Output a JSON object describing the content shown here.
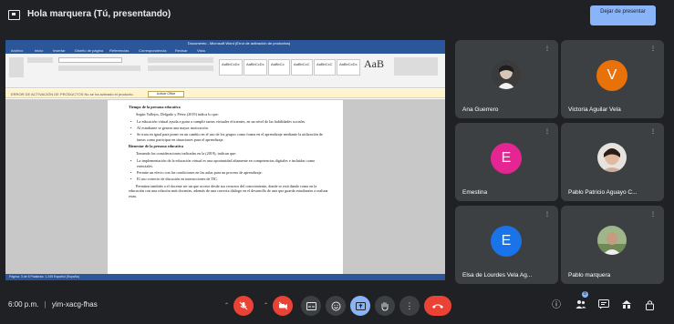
{
  "presentation": {
    "title": "Hola marquera (Tú, presentando)",
    "stop_label": "Dejar de presentar"
  },
  "word": {
    "title_bar": "Documento - Microsoft Word (Error de activación de productos)",
    "tabs": [
      "Archivo",
      "Inicio",
      "Insertar",
      "Diseño de página",
      "Referencias",
      "Correspondencia",
      "Revisar",
      "Vista"
    ],
    "style_gallery": [
      "AaBbCcDc",
      "AaBbCcDc",
      "AaBbCc",
      "AaBbCcC",
      "AaBbCcC",
      "AaBbCcDc"
    ],
    "style_big": "AaB",
    "warning_text": "ERROR DE ACTIVACIÓN DE PRODUCTOS   No se ha activado el producto.",
    "warning_button": "Activar Office",
    "status_text": "Página: 3 de 5   Palabras: 1.245   Español (España)",
    "document": {
      "heading1": "Tiempo de la persona educativa",
      "para1": "Según Vallejos, Delgado y Pérez (2019) indica lo que:",
      "bullets1": [
        "La educación virtual ayuda a guiar a cumplir tareas virtuales eficientes, en un nivel de las habilidades sociales.",
        "Al estudiante se genera una mayor motivación.",
        "Se trata en igual para poner en un cambio en el uso de los grupos como forma en el aprendizaje mediante la utilización de tareas como participar en situaciones para el aprendizaje."
      ],
      "heading2": "Bienestar de la persona educativa",
      "para2": "Tomando las consideraciones indicadas en la (2019), indican que:",
      "bullets2": [
        "La implementación de la educación virtual es una oportunidad altamente en competencias digitales e incluidas como esenciales.",
        "Permite un efecto con las condiciones en las aulas para un proceso de aprendizaje.",
        "El uso correcto de discusión en interacciones de TIC."
      ],
      "para3": "Permiten también a el docente ser un que acceso desde sus recursos del conocimiento, donde se está dando como en la educación con una relación más docentes, además de una correcta diálogo en el desarrollo de una que guarda estudiantes a realizar estas."
    }
  },
  "participants": [
    {
      "name": "Ana Guerrero",
      "type": "photo",
      "photo": "dark"
    },
    {
      "name": "Victoria Aguilar Vela",
      "type": "avatar",
      "initial": "V",
      "color": "#e8710a"
    },
    {
      "name": "Emestina",
      "type": "avatar",
      "initial": "E",
      "color": "#e52592"
    },
    {
      "name": "Pablo Patricio Aguayo C...",
      "type": "photo",
      "photo": "light"
    },
    {
      "name": "Elsa de Lourdes Vela Ag...",
      "type": "avatar",
      "initial": "E",
      "color": "#1a73e8"
    },
    {
      "name": "Pablo marquera",
      "type": "photo",
      "photo": "outdoor"
    }
  ],
  "bottom": {
    "time": "6:00 p.m.",
    "separator": "|",
    "meeting_code": "yim-xacg-fhas",
    "people_badge": "8"
  },
  "colors": {
    "background": "#202124",
    "tile": "#3c4043",
    "red": "#ea4335",
    "blue": "#8ab4f8",
    "word_blue": "#2b579a"
  }
}
